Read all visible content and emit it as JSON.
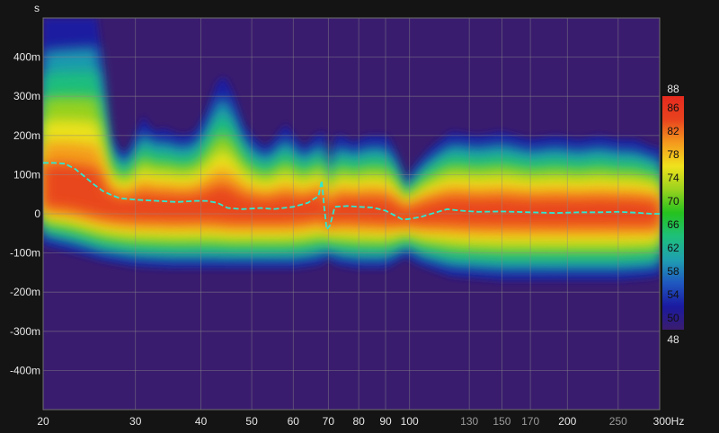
{
  "chart_data": {
    "type": "heatmap",
    "title": "",
    "y_unit_label": "s",
    "x_scale": "log",
    "x_range": [
      20,
      300
    ],
    "y_range": [
      -0.5,
      0.5
    ],
    "x_ticks": [
      {
        "value": 20,
        "label": "20",
        "dim": false
      },
      {
        "value": 30,
        "label": "30",
        "dim": false
      },
      {
        "value": 40,
        "label": "40",
        "dim": false
      },
      {
        "value": 50,
        "label": "50",
        "dim": false
      },
      {
        "value": 60,
        "label": "60",
        "dim": false
      },
      {
        "value": 70,
        "label": "70",
        "dim": false
      },
      {
        "value": 80,
        "label": "80",
        "dim": false
      },
      {
        "value": 90,
        "label": "90",
        "dim": false
      },
      {
        "value": 100,
        "label": "100",
        "dim": false
      },
      {
        "value": 130,
        "label": "130",
        "dim": true
      },
      {
        "value": 150,
        "label": "150",
        "dim": true
      },
      {
        "value": 170,
        "label": "170",
        "dim": true
      },
      {
        "value": 200,
        "label": "200",
        "dim": false
      },
      {
        "value": 250,
        "label": "250",
        "dim": true
      },
      {
        "value": 300,
        "label": "300Hz",
        "dim": false
      }
    ],
    "y_ticks": [
      {
        "value": 0.4,
        "label": "400m"
      },
      {
        "value": 0.3,
        "label": "300m"
      },
      {
        "value": 0.2,
        "label": "200m"
      },
      {
        "value": 0.1,
        "label": "100m"
      },
      {
        "value": 0,
        "label": "0"
      },
      {
        "value": -0.1,
        "label": "-100m"
      },
      {
        "value": -0.2,
        "label": "-200m"
      },
      {
        "value": -0.3,
        "label": "-300m"
      },
      {
        "value": -0.4,
        "label": "-400m"
      }
    ],
    "colorbar": {
      "min": 48,
      "max": 88,
      "min_label": "48",
      "max_label": "88",
      "tick_labels": [
        "86",
        "82",
        "78",
        "74",
        "70",
        "66",
        "62",
        "58",
        "54",
        "50"
      ],
      "tick_values": [
        86,
        82,
        78,
        74,
        70,
        66,
        62,
        58,
        54,
        50
      ],
      "colors": [
        "#3a1c6e",
        "#1a1aa0",
        "#1f58c0",
        "#1fa0b0",
        "#1ec07a",
        "#25c21f",
        "#9ad21e",
        "#f0e21c",
        "#f59a1e",
        "#e8431e",
        "#e62a1f"
      ]
    },
    "peak_time_curve": {
      "name": "",
      "color": "#2ee8d0",
      "points": [
        [
          20,
          0.13
        ],
        [
          21,
          0.13
        ],
        [
          22,
          0.128
        ],
        [
          23,
          0.115
        ],
        [
          24,
          0.095
        ],
        [
          25,
          0.075
        ],
        [
          26,
          0.058
        ],
        [
          27,
          0.048
        ],
        [
          28,
          0.04
        ],
        [
          30,
          0.036
        ],
        [
          33,
          0.033
        ],
        [
          36,
          0.03
        ],
        [
          39,
          0.033
        ],
        [
          41,
          0.033
        ],
        [
          43,
          0.028
        ],
        [
          45,
          0.015
        ],
        [
          48,
          0.012
        ],
        [
          52,
          0.015
        ],
        [
          55,
          0.012
        ],
        [
          60,
          0.018
        ],
        [
          64,
          0.028
        ],
        [
          67,
          0.045
        ],
        [
          68,
          0.085
        ],
        [
          68.7,
          0.02
        ],
        [
          69.5,
          -0.04
        ],
        [
          70.5,
          -0.03
        ],
        [
          72,
          0.018
        ],
        [
          76,
          0.02
        ],
        [
          80,
          0.018
        ],
        [
          85,
          0.016
        ],
        [
          90,
          0.008
        ],
        [
          94,
          -0.005
        ],
        [
          97,
          -0.015
        ],
        [
          100,
          -0.013
        ],
        [
          105,
          -0.008
        ],
        [
          110,
          0.0
        ],
        [
          118,
          0.012
        ],
        [
          125,
          0.008
        ],
        [
          135,
          0.005
        ],
        [
          150,
          0.006
        ],
        [
          170,
          0.004
        ],
        [
          190,
          0.002
        ],
        [
          210,
          0.004
        ],
        [
          230,
          0.004
        ],
        [
          250,
          0.005
        ],
        [
          270,
          0.003
        ],
        [
          290,
          0.0
        ],
        [
          300,
          0.0
        ]
      ]
    },
    "energy_envelope": {
      "upper_time_s": [
        [
          20,
          0.5
        ],
        [
          22,
          0.5
        ],
        [
          24,
          0.5
        ],
        [
          25.5,
          0.5
        ],
        [
          26.5,
          0.22
        ],
        [
          28,
          0.16
        ],
        [
          29,
          0.16
        ],
        [
          30,
          0.2
        ],
        [
          31,
          0.25
        ],
        [
          32,
          0.22
        ],
        [
          33,
          0.21
        ],
        [
          34,
          0.22
        ],
        [
          35,
          0.21
        ],
        [
          37,
          0.2
        ],
        [
          39,
          0.21
        ],
        [
          41,
          0.26
        ],
        [
          43,
          0.34
        ],
        [
          44.5,
          0.35
        ],
        [
          46,
          0.31
        ],
        [
          48,
          0.23
        ],
        [
          50,
          0.2
        ],
        [
          53,
          0.17
        ],
        [
          56,
          0.2
        ],
        [
          58,
          0.23
        ],
        [
          60,
          0.2
        ],
        [
          63,
          0.17
        ],
        [
          66,
          0.2
        ],
        [
          69,
          0.21
        ],
        [
          70,
          0.1
        ],
        [
          72,
          0.2
        ],
        [
          75,
          0.2
        ],
        [
          78,
          0.18
        ],
        [
          80,
          0.19
        ],
        [
          83,
          0.2
        ],
        [
          87,
          0.2
        ],
        [
          91,
          0.2
        ],
        [
          95,
          0.14
        ],
        [
          98,
          0.08
        ],
        [
          102,
          0.12
        ],
        [
          110,
          0.17
        ],
        [
          120,
          0.21
        ],
        [
          135,
          0.2
        ],
        [
          150,
          0.21
        ],
        [
          170,
          0.19
        ],
        [
          190,
          0.2
        ],
        [
          210,
          0.19
        ],
        [
          230,
          0.2
        ],
        [
          250,
          0.19
        ],
        [
          270,
          0.19
        ],
        [
          290,
          0.17
        ],
        [
          300,
          0.17
        ]
      ],
      "lower_time_s": [
        [
          20,
          -0.08
        ],
        [
          23,
          -0.1
        ],
        [
          26,
          -0.12
        ],
        [
          30,
          -0.135
        ],
        [
          35,
          -0.14
        ],
        [
          40,
          -0.14
        ],
        [
          50,
          -0.14
        ],
        [
          60,
          -0.14
        ],
        [
          68,
          -0.13
        ],
        [
          70,
          -0.11
        ],
        [
          72,
          -0.13
        ],
        [
          80,
          -0.14
        ],
        [
          90,
          -0.14
        ],
        [
          98,
          -0.11
        ],
        [
          104,
          -0.13
        ],
        [
          120,
          -0.16
        ],
        [
          150,
          -0.17
        ],
        [
          200,
          -0.17
        ],
        [
          250,
          -0.17
        ],
        [
          280,
          -0.165
        ],
        [
          300,
          -0.16
        ]
      ],
      "peak_level_by_frequency": [
        [
          20,
          72
        ],
        [
          25,
          73
        ],
        [
          30,
          76
        ],
        [
          40,
          78
        ],
        [
          44,
          79
        ],
        [
          50,
          76
        ],
        [
          60,
          76
        ],
        [
          70,
          74
        ],
        [
          80,
          78
        ],
        [
          90,
          76
        ],
        [
          100,
          70
        ],
        [
          110,
          77
        ],
        [
          130,
          82
        ],
        [
          150,
          84
        ],
        [
          170,
          83
        ],
        [
          200,
          80
        ],
        [
          230,
          83
        ],
        [
          260,
          82
        ],
        [
          300,
          80
        ]
      ]
    }
  }
}
